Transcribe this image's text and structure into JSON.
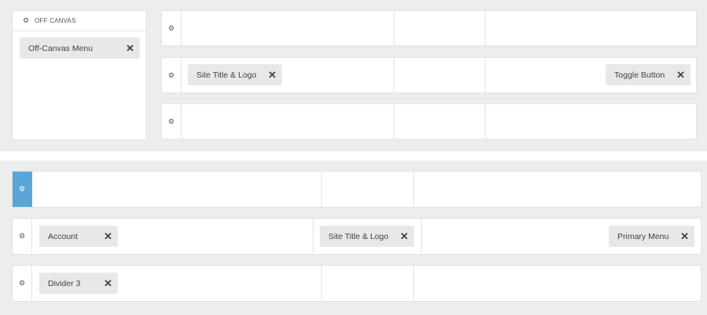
{
  "off_canvas": {
    "title": "OFF CANVAS",
    "items": [
      {
        "label": "Off-Canvas Menu"
      }
    ]
  },
  "mobile_rows": [
    {
      "items": []
    },
    {
      "items": [
        {
          "label": "Site Title & Logo"
        },
        {
          "label": "Toggle Button"
        }
      ]
    },
    {
      "items": []
    }
  ],
  "desktop_rows": [
    {
      "items": []
    },
    {
      "items": [
        {
          "label": "Account"
        },
        {
          "label": "Site Title & Logo"
        },
        {
          "label": "Primary Menu"
        }
      ]
    },
    {
      "items": [
        {
          "label": "Divider 3"
        }
      ]
    }
  ],
  "icons": {
    "gear": "⚙",
    "close": "✕"
  },
  "colors": {
    "active_row": "#5aa6d6",
    "chip_bg": "#e8e8e8",
    "panel_bg": "#ededed"
  }
}
